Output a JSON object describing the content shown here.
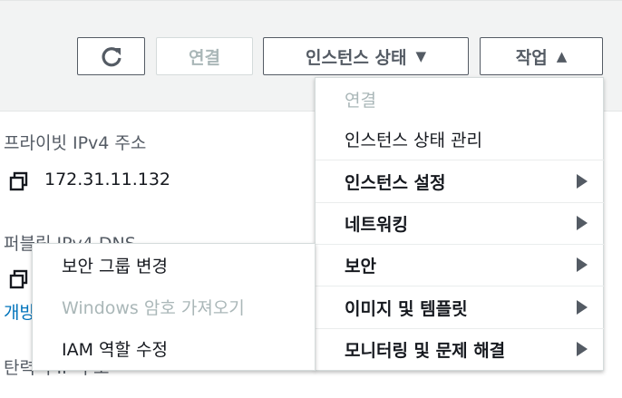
{
  "toolbar": {
    "connect_label": "연결",
    "instance_state_label": "인스턴스 상태",
    "actions_label": "작업"
  },
  "details": {
    "private_ip_label": "프라이빗 IPv4 주소",
    "private_ip_value": "172.31.11.132",
    "public_dns_label": "퍼블릭 IPv4 DNS",
    "link_partial": "개방",
    "bottom_label_partial": "탄력적 IP 주소"
  },
  "actions_menu": {
    "items": [
      {
        "label": "연결",
        "disabled": true
      },
      {
        "label": "인스턴스 상태 관리"
      },
      {
        "label": "인스턴스 설정",
        "submenu": true
      },
      {
        "label": "네트워킹",
        "submenu": true
      },
      {
        "label": "보안",
        "submenu": true,
        "active": true
      },
      {
        "label": "이미지 및 템플릿",
        "submenu": true
      },
      {
        "label": "모니터링 및 문제 해결",
        "submenu": true
      }
    ]
  },
  "security_submenu": {
    "items": [
      {
        "label": "보안 그룹 변경"
      },
      {
        "label": "Windows 암호 가져오기",
        "disabled": true
      },
      {
        "label": "IAM 역할 수정"
      }
    ]
  },
  "icons": {
    "refresh": "refresh-icon",
    "copy": "copy-icon",
    "caret_down": "caret-down-icon",
    "caret_up": "caret-up-icon",
    "submenu_arrow": "caret-right-icon"
  }
}
